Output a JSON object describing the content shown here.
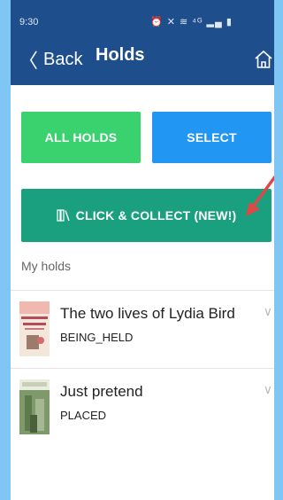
{
  "status_bar": {
    "time": "9:30",
    "icons": "⏰ ✕ ≋ ⁴ᴳ ▂▄ ▮"
  },
  "app_bar": {
    "back_label": "Back",
    "back_icon": "chevron-left-icon",
    "title": "Holds",
    "home_icon": "home-icon"
  },
  "buttons": {
    "all_holds": "ALL HOLDS",
    "select": "SELECT",
    "click_collect": "CLICK & COLLECT (NEW!)",
    "click_collect_icon": "books-icon"
  },
  "section_label": "My holds",
  "holds": [
    {
      "title": "The two lives of Lydia Bird",
      "status": "BEING_HELD"
    },
    {
      "title": "Just pretend",
      "status": "PLACED"
    }
  ],
  "colors": {
    "app_bar": "#1f4e8c",
    "all_holds": "#3ad26e",
    "select": "#2196f3",
    "click_collect": "#1aa07f",
    "annotation_arrow": "#e04848",
    "backdrop": "#7fc6f5"
  }
}
